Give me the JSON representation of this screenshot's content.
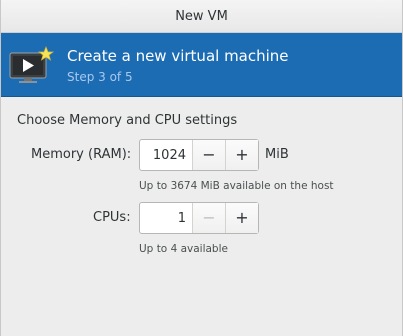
{
  "window": {
    "title": "New VM"
  },
  "banner": {
    "icon": "monitor-play-icon",
    "heading": "Create a new virtual machine",
    "step": "Step 3 of 5",
    "colors": {
      "background": "#1c6cb4",
      "step_text": "#a9c9ee"
    }
  },
  "settings": {
    "section_title": "Choose Memory and CPU settings",
    "memory": {
      "label": "Memory (RAM):",
      "value": "1024",
      "unit": "MiB",
      "decrement_label": "−",
      "increment_label": "+",
      "hint": "Up to 3674 MiB available on the host"
    },
    "cpus": {
      "label": "CPUs:",
      "value": "1",
      "decrement_label": "−",
      "increment_label": "+",
      "decrement_disabled": true,
      "hint": "Up to 4 available"
    }
  }
}
